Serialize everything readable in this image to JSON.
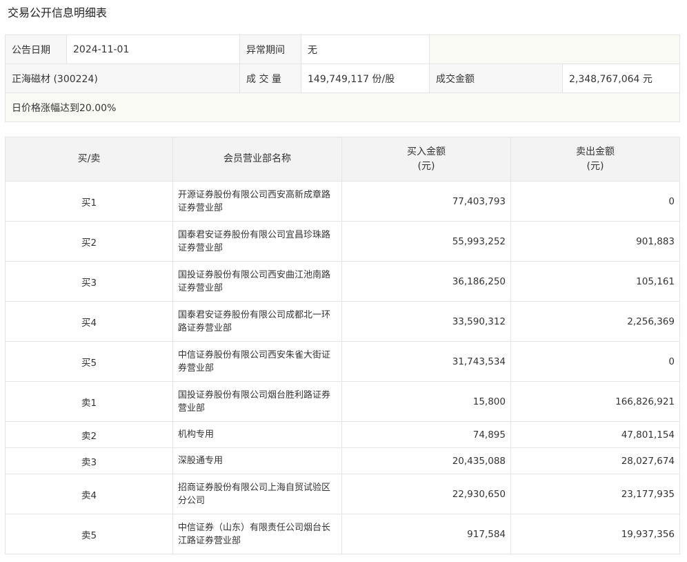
{
  "page": {
    "title": "交易公开信息明细表"
  },
  "summary": {
    "announce_date_label": "公告日期",
    "announce_date": "2024-11-01",
    "abnormal_period_label": "异常期间",
    "abnormal_period": "无",
    "stock": "正海磁材 (300224)",
    "volume_label": "成 交 量",
    "volume": "149,749,117 份/股",
    "amount_label": "成交金额",
    "amount": "2,348,767,064 元",
    "note": "日价格涨幅达到20.00%"
  },
  "detail": {
    "headers": {
      "side": "买/卖",
      "member": "会员营业部名称",
      "buy_line1": "买入金额",
      "buy_line2": "(元)",
      "sell_line1": "卖出金额",
      "sell_line2": "(元)"
    },
    "rows": [
      {
        "side": "买1",
        "member": "开源证券股份有限公司西安高新成章路证券营业部",
        "buy": "77,403,793",
        "sell": "0"
      },
      {
        "side": "买2",
        "member": "国泰君安证券股份有限公司宜昌珍珠路证券营业部",
        "buy": "55,993,252",
        "sell": "901,883"
      },
      {
        "side": "买3",
        "member": "国投证券股份有限公司西安曲江池南路证券营业部",
        "buy": "36,186,250",
        "sell": "105,161"
      },
      {
        "side": "买4",
        "member": "国泰君安证券股份有限公司成都北一环路证券营业部",
        "buy": "33,590,312",
        "sell": "2,256,369"
      },
      {
        "side": "买5",
        "member": "中信证券股份有限公司西安朱雀大街证券营业部",
        "buy": "31,743,534",
        "sell": "0"
      },
      {
        "side": "卖1",
        "member": "国投证券股份有限公司烟台胜利路证券营业部",
        "buy": "15,800",
        "sell": "166,826,921"
      },
      {
        "side": "卖2",
        "member": "机构专用",
        "buy": "74,895",
        "sell": "47,801,154"
      },
      {
        "side": "卖3",
        "member": "深股通专用",
        "buy": "20,435,088",
        "sell": "28,027,674"
      },
      {
        "side": "卖4",
        "member": "招商证券股份有限公司上海自贸试验区分公司",
        "buy": "22,930,650",
        "sell": "23,177,935"
      },
      {
        "side": "卖5",
        "member": "中信证券（山东）有限责任公司烟台长江路证券营业部",
        "buy": "917,584",
        "sell": "19,937,356"
      }
    ]
  }
}
